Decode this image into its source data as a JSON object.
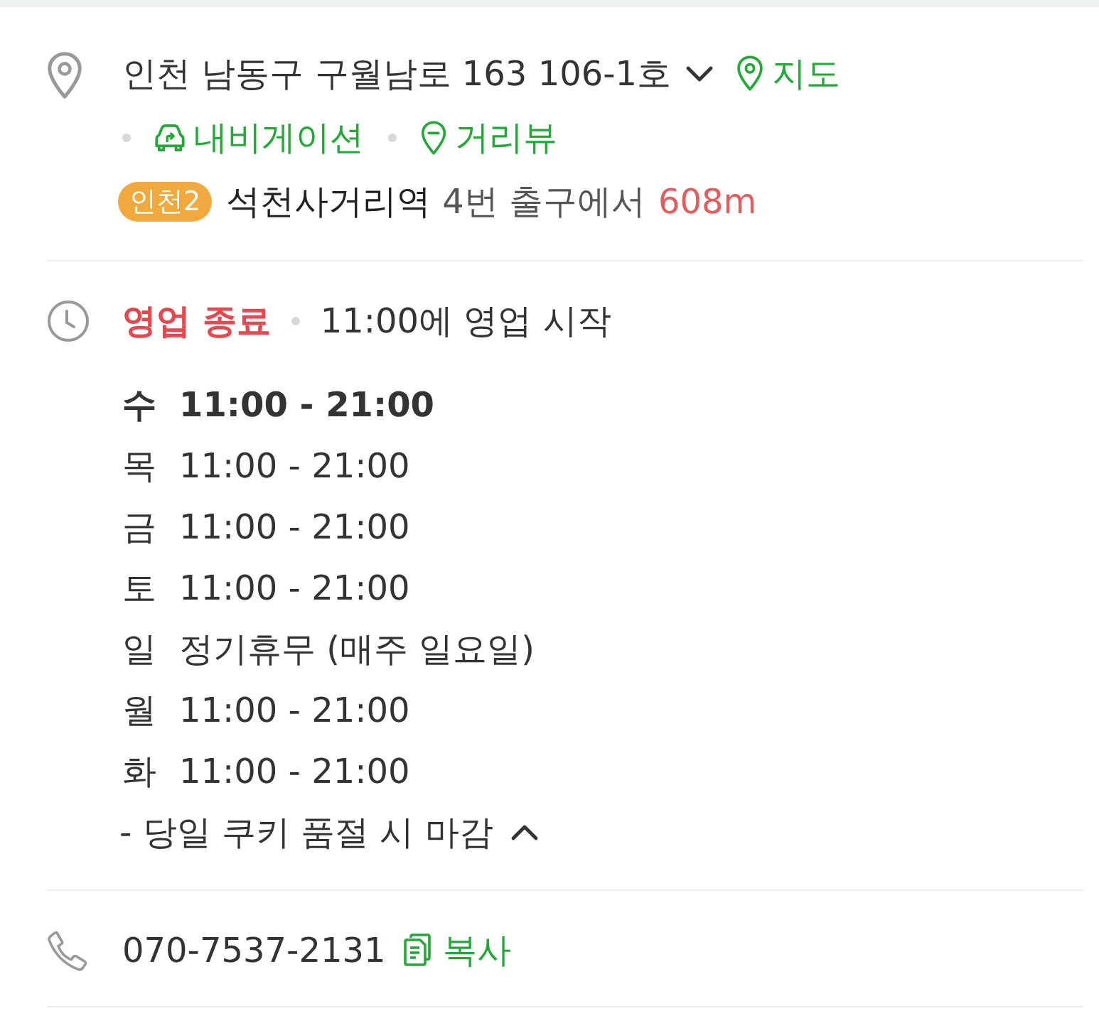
{
  "address": {
    "text": "인천 남동구 구월남로 163 106-1호",
    "expanded": false,
    "map_link": "지도",
    "links": [
      {
        "kind": "navigation",
        "label": "내비게이션"
      },
      {
        "kind": "street_view",
        "label": "거리뷰"
      }
    ]
  },
  "subway": {
    "line": "인천2",
    "color": "#f0a93c",
    "station": "석천사거리역",
    "exit": "4번 출구에서",
    "distance": "608m"
  },
  "hours": {
    "status": "영업 종료",
    "next": "11:00에 영업 시작",
    "expanded": true,
    "days": [
      {
        "day": "수",
        "time": "11:00 - 21:00",
        "today": true
      },
      {
        "day": "목",
        "time": "11:00 - 21:00",
        "today": false
      },
      {
        "day": "금",
        "time": "11:00 - 21:00",
        "today": false
      },
      {
        "day": "토",
        "time": "11:00 - 21:00",
        "today": false
      },
      {
        "day": "일",
        "time": "정기휴무 (매주 일요일)",
        "today": false
      },
      {
        "day": "월",
        "time": "11:00 - 21:00",
        "today": false
      },
      {
        "day": "화",
        "time": "11:00 - 21:00",
        "today": false
      }
    ],
    "note": "- 당일 쿠키 품절 시 마감"
  },
  "phone": {
    "number": "070-7537-2131",
    "copy_label": "복사"
  }
}
